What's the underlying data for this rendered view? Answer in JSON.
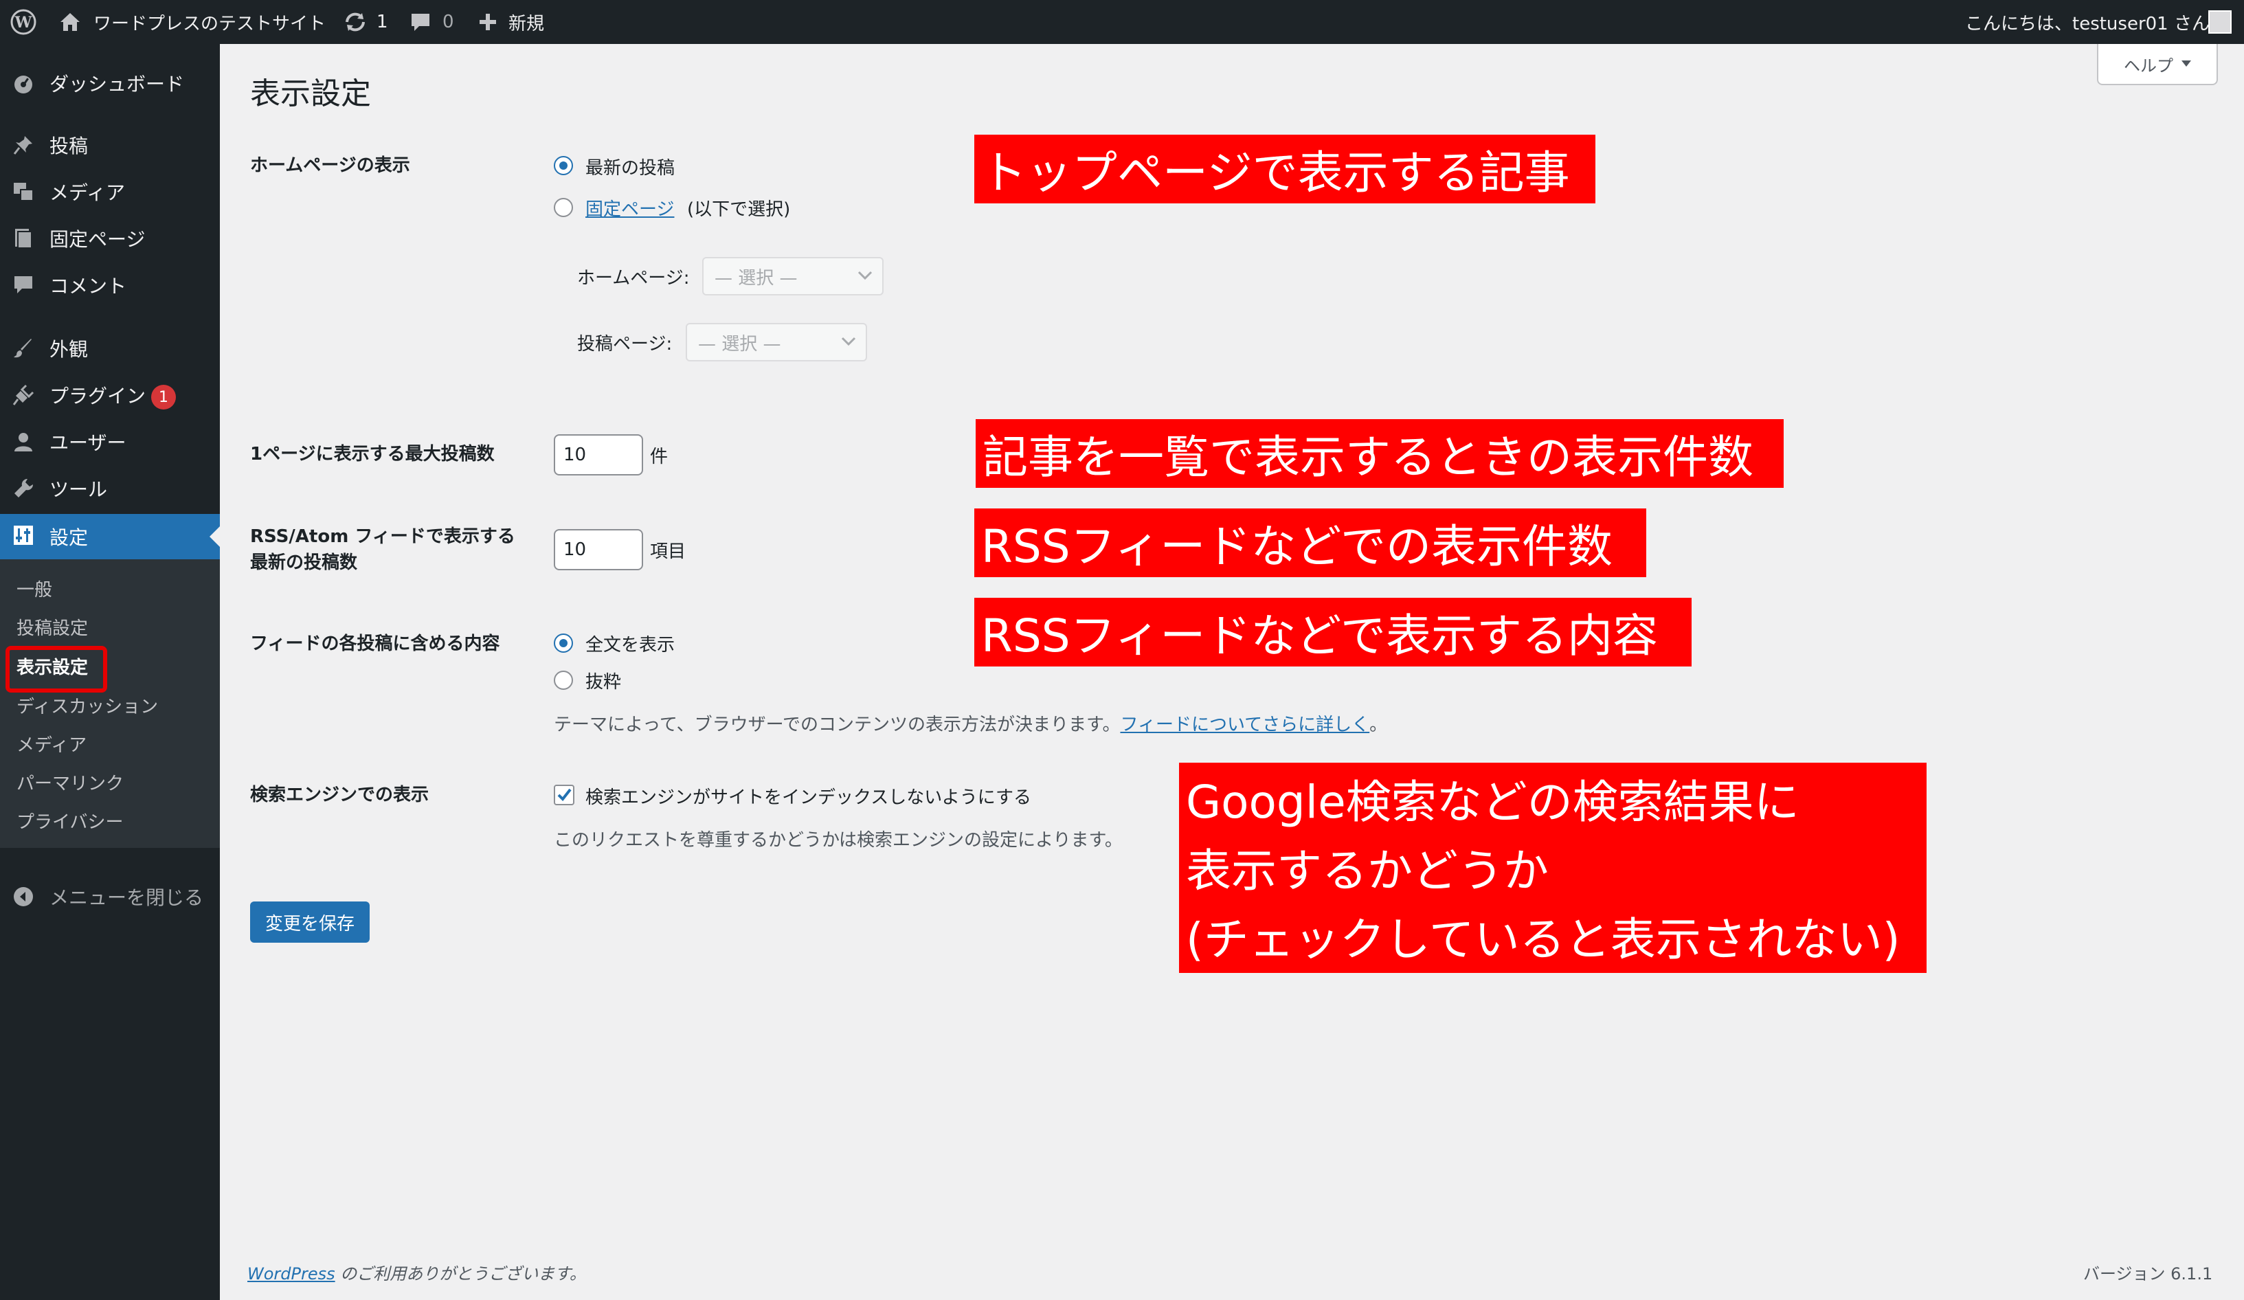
{
  "adminbar": {
    "site_name": "ワードプレスのテストサイト",
    "updates_count": "1",
    "comments_count": "0",
    "new_label": "新規",
    "greeting": "こんにちは、testuser01 さん"
  },
  "sidebar": {
    "dashboard": "ダッシュボード",
    "posts": "投稿",
    "media": "メディア",
    "pages": "固定ページ",
    "comments": "コメント",
    "appearance": "外観",
    "plugins": "プラグイン",
    "plugins_badge": "1",
    "users": "ユーザー",
    "tools": "ツール",
    "settings": "設定",
    "submenu": [
      "一般",
      "投稿設定",
      "表示設定",
      "ディスカッション",
      "メディア",
      "パーマリンク",
      "プライバシー"
    ],
    "collapse": "メニューを閉じる"
  },
  "help_tab": "ヘルプ",
  "page_title": "表示設定",
  "homepage": {
    "label": "ホームページの表示",
    "option_latest": "最新の投稿",
    "option_static_link": "固定ページ",
    "option_static_suffix": "(以下で選択)",
    "homepage_label": "ホームページ:",
    "posts_page_label": "投稿ページ:",
    "select_placeholder": "— 選択 —"
  },
  "posts_per_page": {
    "label": "1ページに表示する最大投稿数",
    "value": "10",
    "unit": "件"
  },
  "rss": {
    "label_line1": "RSS/Atom フィードで表示する",
    "label_line2": "最新の投稿数",
    "value": "10",
    "unit": "項目"
  },
  "feed_content": {
    "label": "フィードの各投稿に含める内容",
    "option_full": "全文を表示",
    "option_excerpt": "抜粋",
    "description": "テーマによって、ブラウザーでのコンテンツの表示方法が決まります。",
    "link": "フィードについてさらに詳しく",
    "after_link": "。"
  },
  "search_engine": {
    "label": "検索エンジンでの表示",
    "checkbox_label": "検索エンジンがサイトをインデックスしないようにする",
    "description": "このリクエストを尊重するかどうかは検索エンジンの設定によります。"
  },
  "save_button": "変更を保存",
  "footer": {
    "left_link": "WordPress",
    "left_text": " のご利用ありがとうございます。",
    "version": "バージョン 6.1.1"
  },
  "annotations": {
    "homepage": "トップページで表示する記事",
    "posts_per_page": "記事を一覧で表示するときの表示件数",
    "rss_count": "RSSフィードなどでの表示件数",
    "rss_content": "RSSフィードなどで表示する内容",
    "search_line1": "Google検索などの検索結果に",
    "search_line2": "表示するかどうか",
    "search_line3": "(チェックしていると表示されない)"
  },
  "colors": {
    "adminbar": "#1d2327",
    "accent": "#2271b1",
    "annotation": "#ff0000",
    "badge": "#d63638"
  }
}
